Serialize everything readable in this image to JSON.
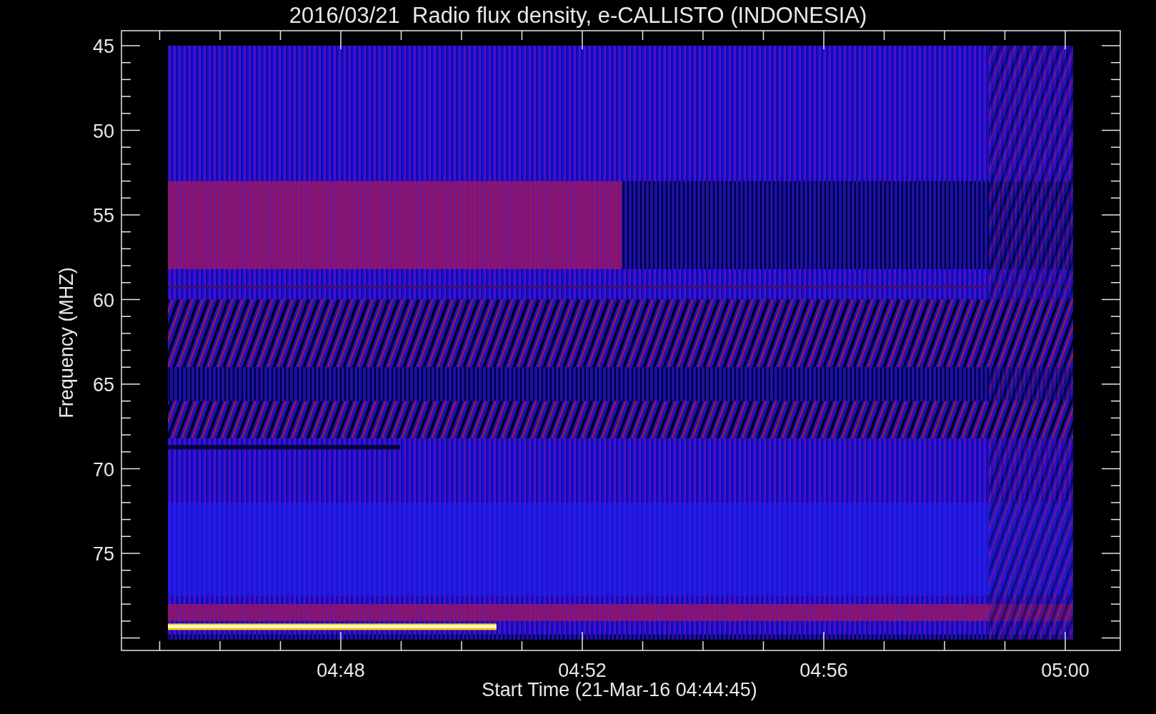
{
  "title": "2016/03/21  Radio flux density, e-CALLISTO (INDONESIA)",
  "y_axis": {
    "label": "Frequency (MHZ)",
    "ticks": [
      "45",
      "50",
      "55",
      "60",
      "65",
      "70",
      "75"
    ]
  },
  "x_axis": {
    "label": "Start Time (21-Mar-16 04:44:45)",
    "ticks": [
      "04:48",
      "04:52",
      "04:56",
      "05:00"
    ]
  }
}
